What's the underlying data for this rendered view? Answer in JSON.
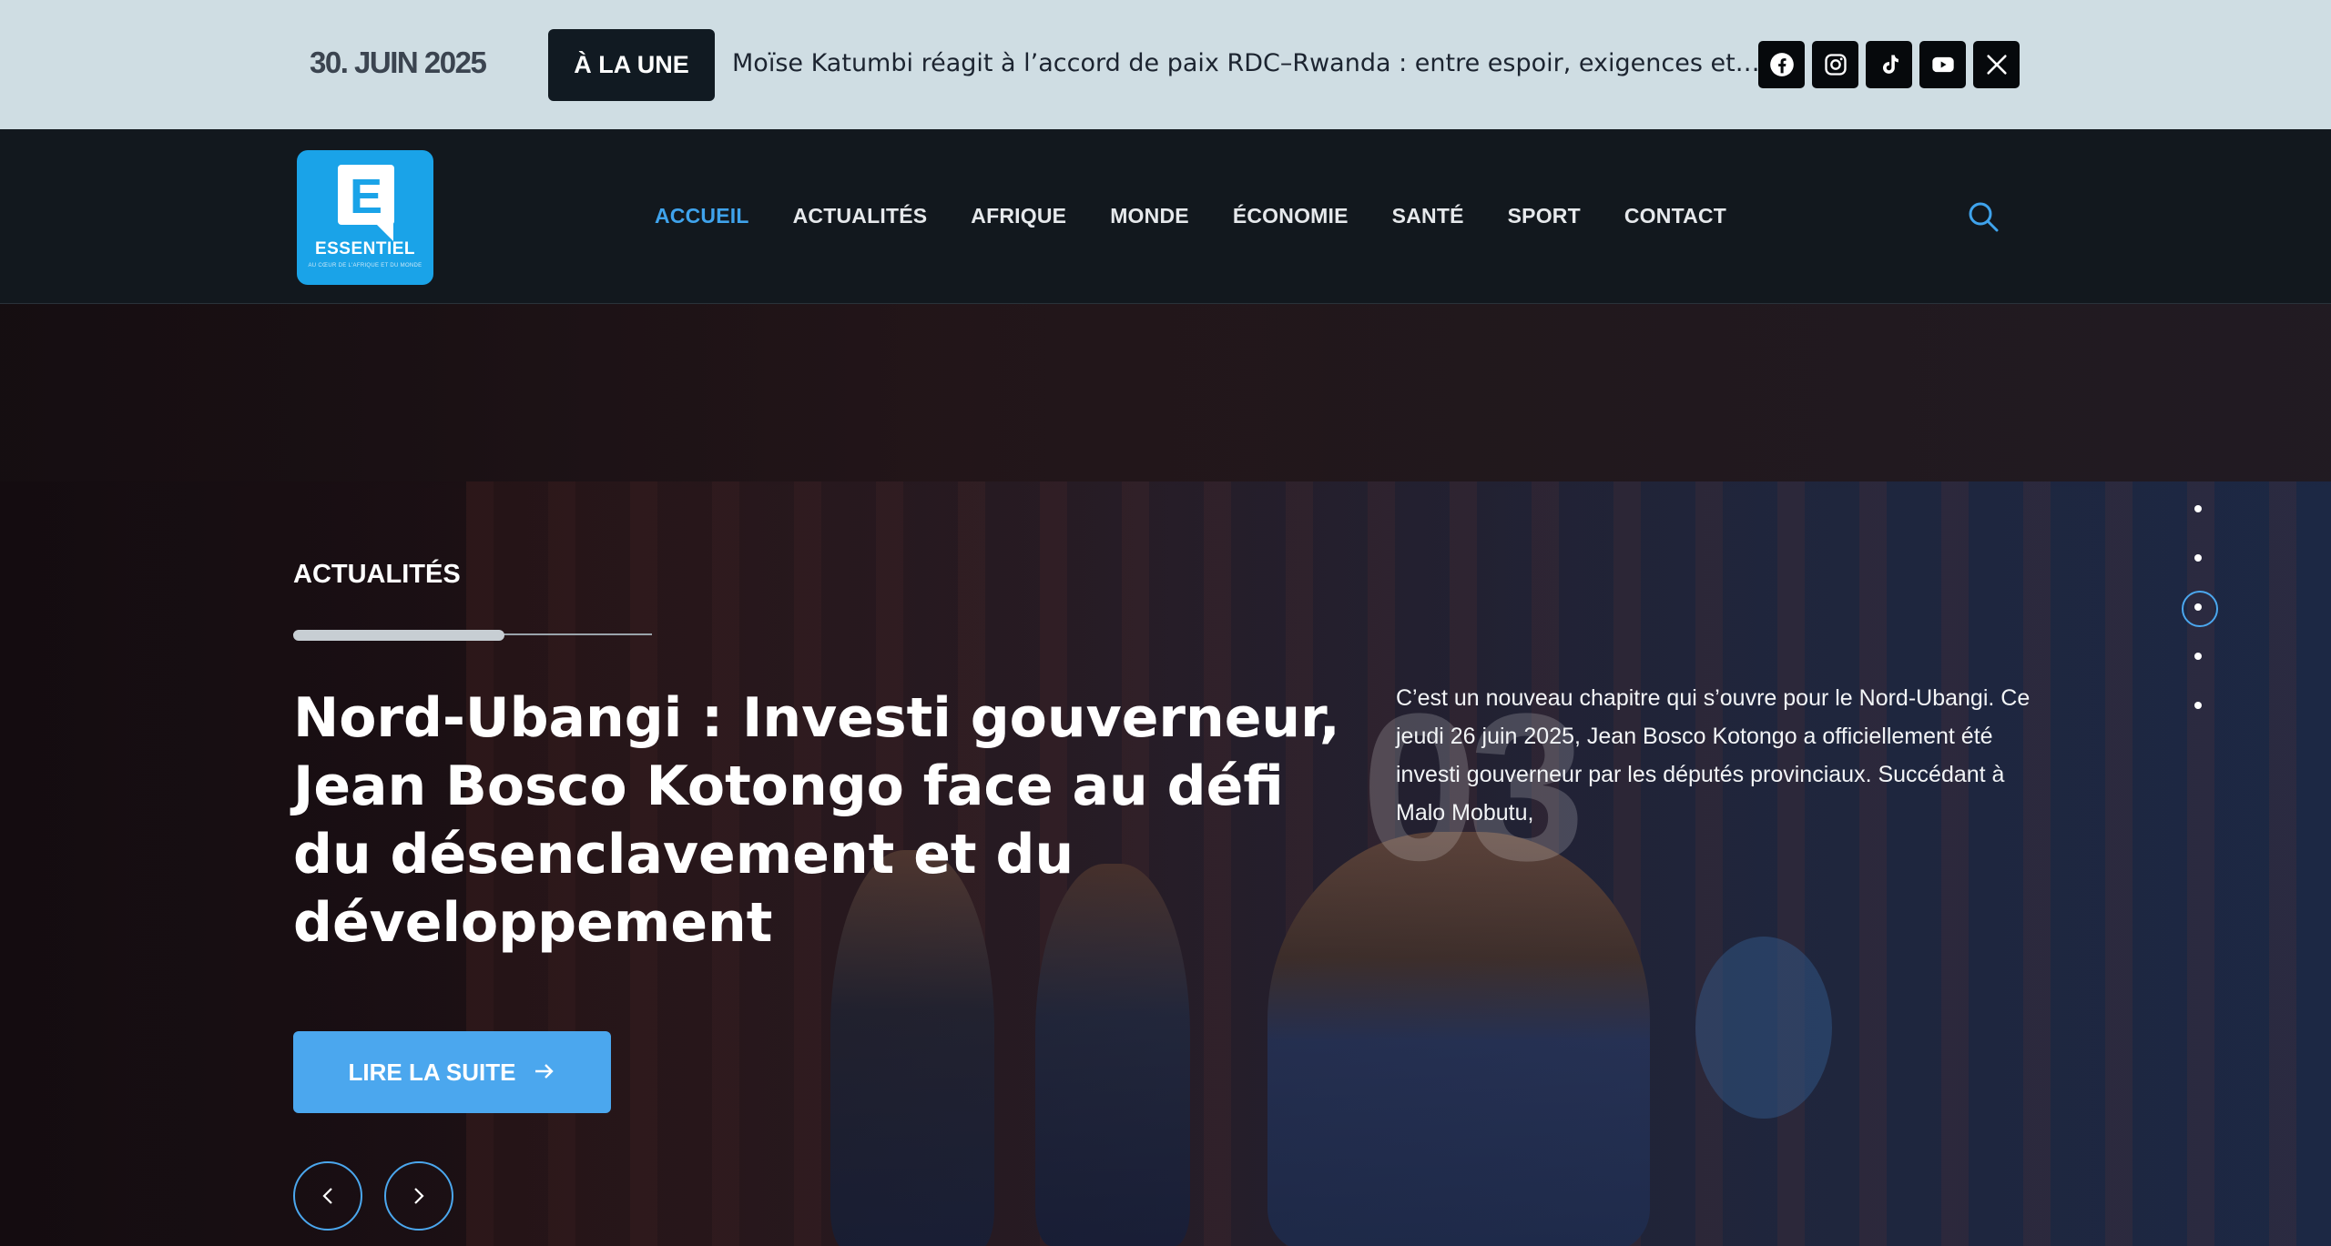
{
  "topbar": {
    "date": "30. JUIN 2025",
    "badge": "À LA UNE",
    "ticker": "Moïse Katumbi réagit à l’accord de paix RDC–Rwanda : entre espoir, exigences et…",
    "socials": [
      "facebook-icon",
      "instagram-icon",
      "tiktok-icon",
      "youtube-icon",
      "x-icon"
    ]
  },
  "header": {
    "logo": {
      "letter": "E",
      "wordmark": "ESSENTIEL",
      "tagline": "AU CŒUR DE L'AFRIQUE ET DU MONDE"
    },
    "nav": [
      {
        "label": "ACCUEIL",
        "active": true
      },
      {
        "label": "ACTUALITÉS",
        "active": false
      },
      {
        "label": "AFRIQUE",
        "active": false
      },
      {
        "label": "MONDE",
        "active": false
      },
      {
        "label": "ÉCONOMIE",
        "active": false
      },
      {
        "label": "SANTÉ",
        "active": false
      },
      {
        "label": "SPORT",
        "active": false
      },
      {
        "label": "CONTACT",
        "active": false
      }
    ],
    "search_icon": "search-icon"
  },
  "hero": {
    "category": "ACTUALITÉS",
    "progress": 0.59,
    "headline": "Nord-Ubangi : Investi gouverneur, Jean Bosco Kotongo face au défi du désenclavement et du développement",
    "slide_number": "03",
    "excerpt": "C’est un nouveau chapitre qui s’ouvre pour le Nord-Ubangi. Ce jeudi 26 juin 2025, Jean Bosco Kotongo a officiellement été investi gouverneur par les députés provinciaux. Succédant à Malo Mobutu,",
    "read_more": "LIRE LA SUITE",
    "slides_count": 5,
    "active_slide": 3
  },
  "colors": {
    "accent": "#4ba7ee",
    "topbar": "#cfdde3",
    "navbar": "#12181e",
    "logo": "#1aa3e8"
  }
}
